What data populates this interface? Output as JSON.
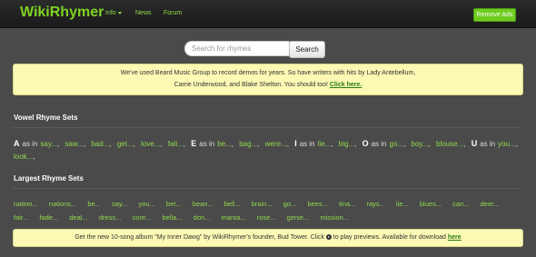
{
  "nav": {
    "brand": "WikiRhymer",
    "info": "Info",
    "news": "News",
    "forum": "Forum",
    "remove_ads": "Remove Ads"
  },
  "search": {
    "placeholder": "Search for rhymes",
    "button": "Search"
  },
  "banner_top": {
    "line1": "We've used Beard Music Group to record demos for years. So have writers with hits by Lady Antebellum,",
    "line2": "Carrie Underwood, and Blake Shelton. You should too!",
    "link": "Click here."
  },
  "vowel_section": {
    "title": "Vowel Rhyme Sets",
    "as_in": "as in",
    "groups": [
      {
        "vowel": "A",
        "words": [
          "say...",
          "saw...",
          "bad...",
          "get...",
          "love...",
          "fall..."
        ]
      },
      {
        "vowel": "E",
        "words": [
          "be...",
          "bag...",
          "were..."
        ]
      },
      {
        "vowel": "I",
        "words": [
          "lie...",
          "big..."
        ]
      },
      {
        "vowel": "O",
        "words": [
          "go...",
          "boy...",
          "blouse..."
        ]
      },
      {
        "vowel": "U",
        "words": [
          "you...",
          "look..."
        ]
      }
    ]
  },
  "largest_section": {
    "title": "Largest Rhyme Sets",
    "words": [
      "nation...",
      "nations...",
      "be...",
      "say...",
      "you...",
      "bet...",
      "bean...",
      "bell...",
      "brain...",
      "go...",
      "bees...",
      "tina...",
      "rays...",
      "lie...",
      "blues...",
      "can...",
      "deer...",
      "fair...",
      "fade...",
      "deal...",
      "dress...",
      "core...",
      "bella...",
      "don...",
      "manta...",
      "rose...",
      "genie...",
      "mission..."
    ]
  },
  "banner_bottom": {
    "text_before": "Get the new 10-song album \"My Inner Dawg\" by WikiRhymer's founder, Bud Tower. Click",
    "text_after": "to play previews. Available for download",
    "link": "here"
  }
}
